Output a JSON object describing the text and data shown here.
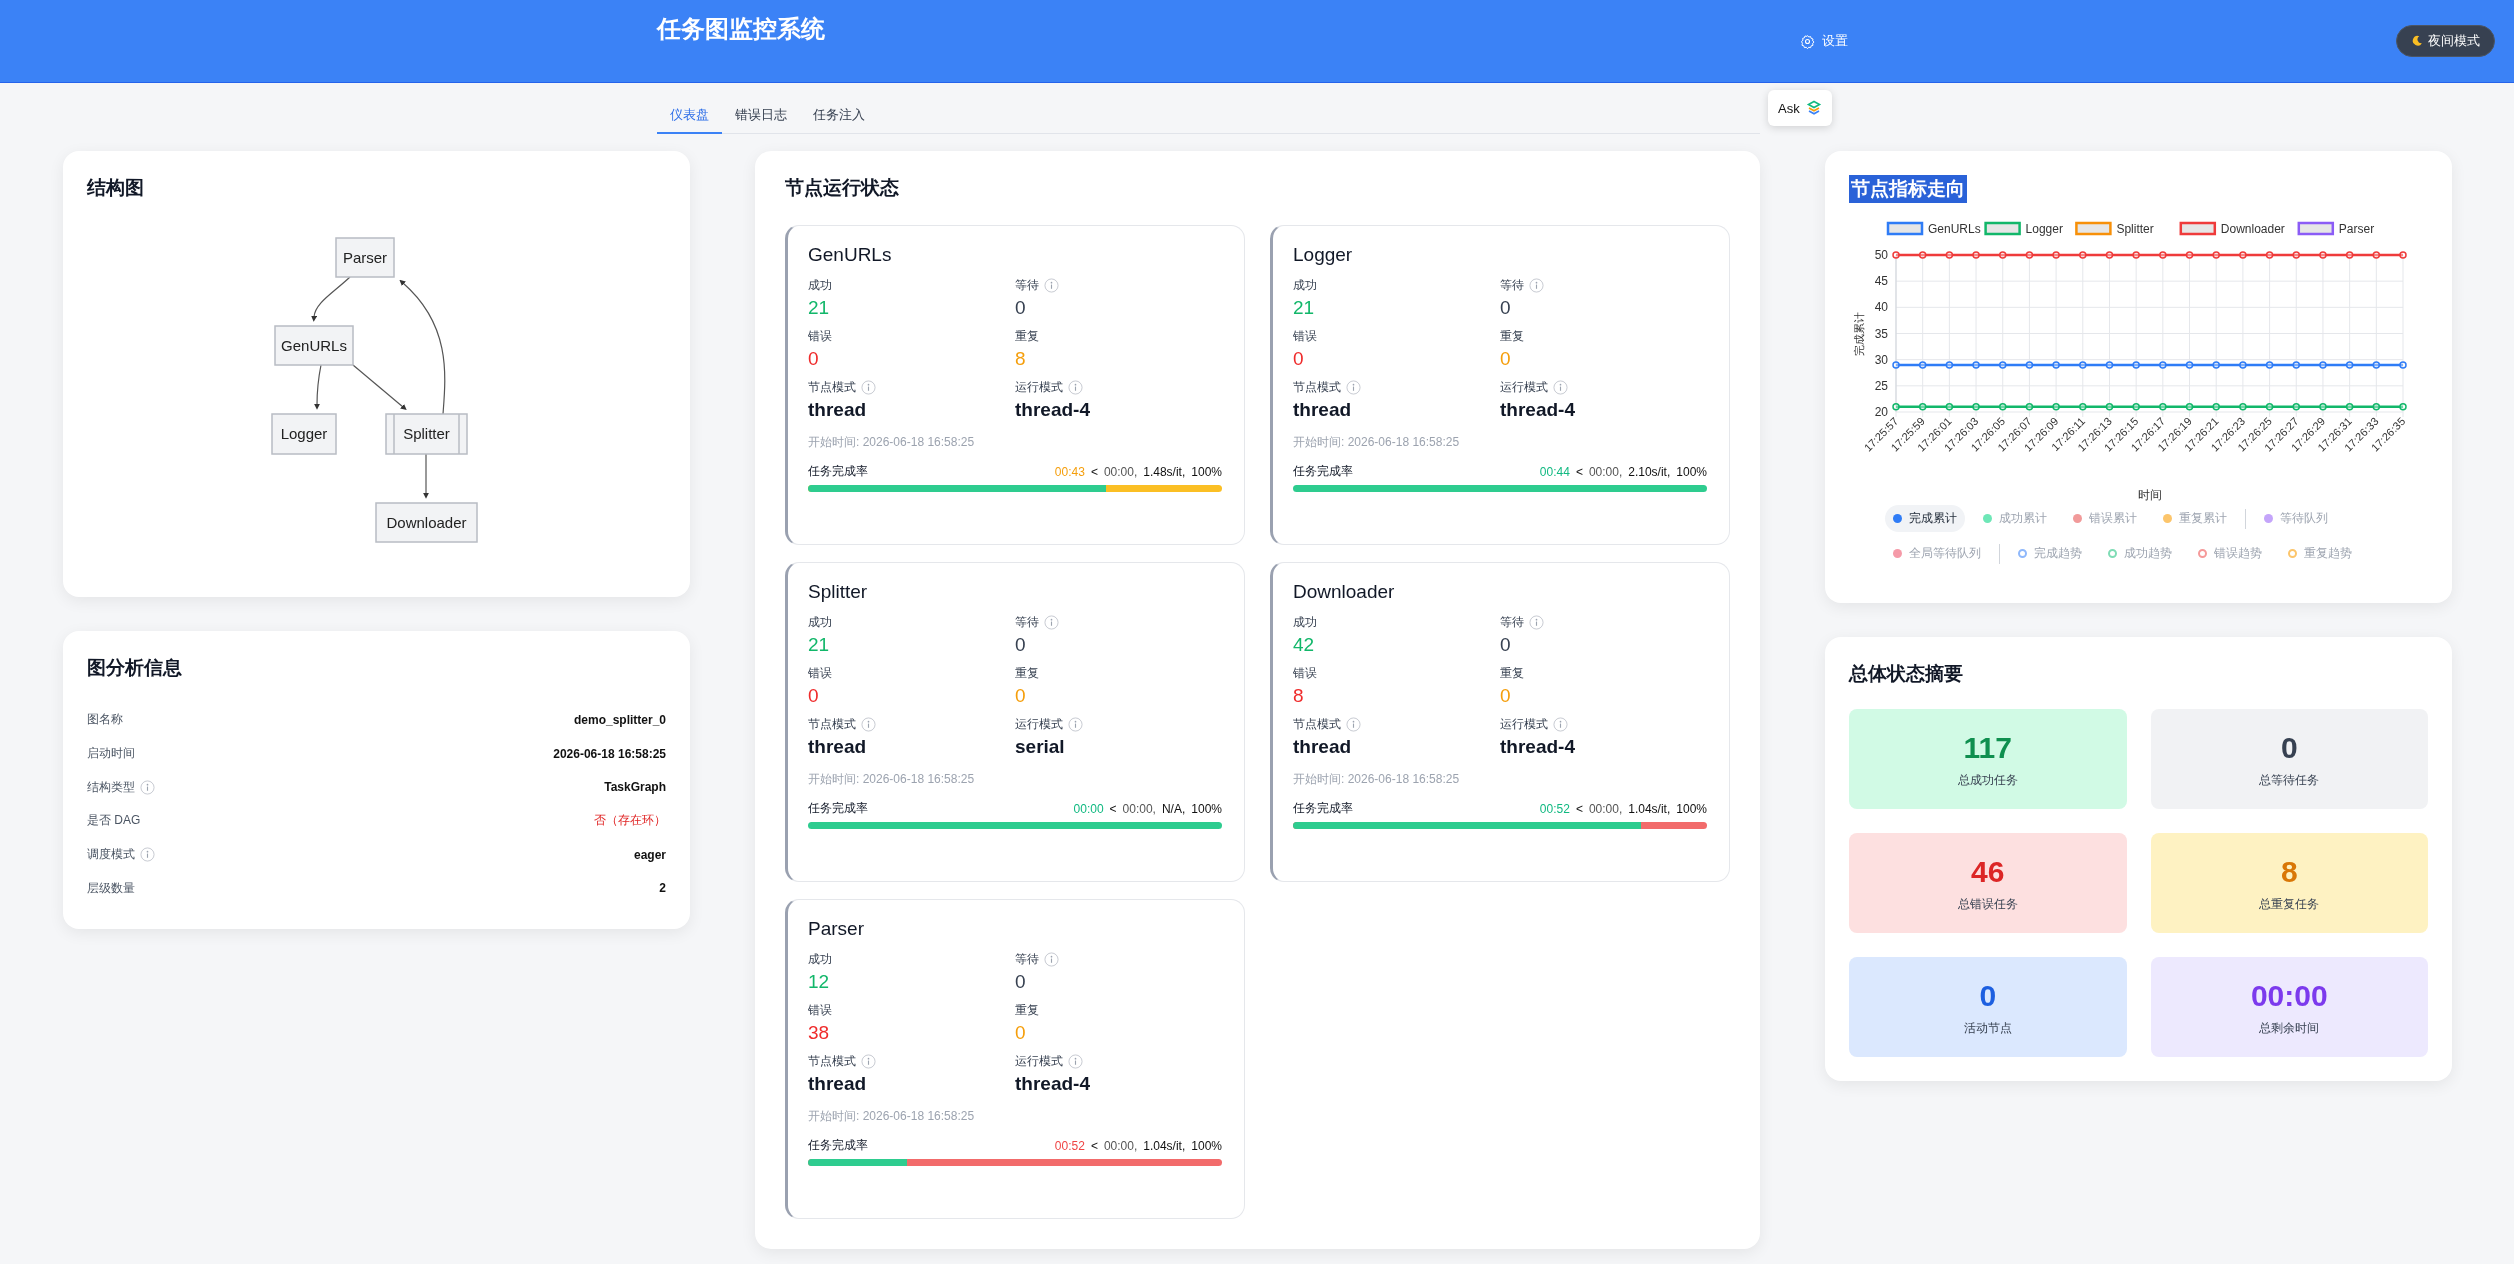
{
  "header": {
    "title": "任务图监控系统",
    "settings": {
      "label": "设置"
    },
    "night_mode": {
      "label": "夜间模式"
    }
  },
  "tabs": [
    {
      "label": "仪表盘",
      "selected": true
    },
    {
      "label": "错误日志",
      "selected": false
    },
    {
      "label": "任务注入",
      "selected": false
    }
  ],
  "ask_button": {
    "label": "Ask"
  },
  "structure": {
    "title": "结构图",
    "nodes": [
      {
        "label": "Parser",
        "kind": "process"
      },
      {
        "label": "GenURLs",
        "kind": "process"
      },
      {
        "label": "Logger",
        "kind": "process"
      },
      {
        "label": "Splitter",
        "kind": "subroutine"
      },
      {
        "label": "Downloader",
        "kind": "process"
      }
    ]
  },
  "graph_info": {
    "title": "图分析信息",
    "rows": [
      {
        "label": "图名称",
        "value": "demo_splitter_0",
        "info": false,
        "alert": false
      },
      {
        "label": "启动时间",
        "value": "2026-06-18 16:58:25",
        "info": false,
        "alert": false
      },
      {
        "label": "结构类型",
        "value": "TaskGraph",
        "info": true,
        "alert": false
      },
      {
        "label": "是否 DAG",
        "value": "否（存在环）",
        "info": false,
        "alert": true
      },
      {
        "label": "调度模式",
        "value": "eager",
        "info": true,
        "alert": false
      },
      {
        "label": "层级数量",
        "value": "2",
        "info": false,
        "alert": false
      }
    ]
  },
  "node_status": {
    "title": "节点运行状态",
    "nodes": [
      {
        "name": "GenURLs",
        "stats": [
          {
            "label": "成功",
            "value": "21",
            "kind": "success",
            "info": false
          },
          {
            "label": "等待",
            "value": "0",
            "kind": "waiting",
            "info": true
          },
          {
            "label": "错误",
            "value": "0",
            "kind": "error",
            "info": false
          },
          {
            "label": "重复",
            "value": "8",
            "kind": "duplicate",
            "info": false
          },
          {
            "label": "节点模式",
            "value": "thread",
            "kind": "mode",
            "info": true
          },
          {
            "label": "运行模式",
            "value": "thread-4",
            "kind": "mode",
            "info": true
          }
        ],
        "start_time": "开始时间: 2026-06-18 16:58:25",
        "progress": {
          "label": "任务完成率",
          "elapsed": {
            "text": "00:43",
            "color": "#f59e0b"
          },
          "separator": "<",
          "remaining": "00:00,",
          "rate": "1.48s/it,",
          "percent": "100%",
          "level": 0.72,
          "color": "#fbbf24"
        }
      },
      {
        "name": "Logger",
        "stats": [
          {
            "label": "成功",
            "value": "21",
            "kind": "success",
            "info": false
          },
          {
            "label": "等待",
            "value": "0",
            "kind": "waiting",
            "info": true
          },
          {
            "label": "错误",
            "value": "0",
            "kind": "error",
            "info": false
          },
          {
            "label": "重复",
            "value": "0",
            "kind": "duplicate",
            "info": false
          },
          {
            "label": "节点模式",
            "value": "thread",
            "kind": "mode",
            "info": true
          },
          {
            "label": "运行模式",
            "value": "thread-4",
            "kind": "mode",
            "info": true
          }
        ],
        "start_time": "开始时间: 2026-06-18 16:58:25",
        "progress": {
          "label": "任务完成率",
          "elapsed": {
            "text": "00:44",
            "color": "#10b981"
          },
          "separator": "<",
          "remaining": "00:00,",
          "rate": "2.10s/it,",
          "percent": "100%",
          "level": 1
        }
      },
      {
        "name": "Splitter",
        "stats": [
          {
            "label": "成功",
            "value": "21",
            "kind": "success",
            "info": false
          },
          {
            "label": "等待",
            "value": "0",
            "kind": "waiting",
            "info": true
          },
          {
            "label": "错误",
            "value": "0",
            "kind": "error",
            "info": false
          },
          {
            "label": "重复",
            "value": "0",
            "kind": "duplicate",
            "info": false
          },
          {
            "label": "节点模式",
            "value": "thread",
            "kind": "mode",
            "info": true
          },
          {
            "label": "运行模式",
            "value": "serial",
            "kind": "mode",
            "info": true
          }
        ],
        "start_time": "开始时间: 2026-06-18 16:58:25",
        "progress": {
          "label": "任务完成率",
          "elapsed": {
            "text": "00:00",
            "color": "#10b981"
          },
          "separator": "<",
          "remaining": "00:00,",
          "rate": "N/A,",
          "percent": "100%",
          "level": 1
        }
      },
      {
        "name": "Downloader",
        "stats": [
          {
            "label": "成功",
            "value": "42",
            "kind": "success",
            "info": false
          },
          {
            "label": "等待",
            "value": "0",
            "kind": "waiting",
            "info": true
          },
          {
            "label": "错误",
            "value": "8",
            "kind": "error",
            "info": false
          },
          {
            "label": "重复",
            "value": "0",
            "kind": "duplicate",
            "info": false
          },
          {
            "label": "节点模式",
            "value": "thread",
            "kind": "mode",
            "info": true
          },
          {
            "label": "运行模式",
            "value": "thread-4",
            "kind": "mode",
            "info": true
          }
        ],
        "start_time": "开始时间: 2026-06-18 16:58:25",
        "progress": {
          "label": "任务完成率",
          "elapsed": {
            "text": "00:52",
            "color": "#10b981"
          },
          "separator": "<",
          "remaining": "00:00,",
          "rate": "1.04s/it,",
          "percent": "100%",
          "level": 0.84,
          "color": "#f26b6b"
        }
      },
      {
        "name": "Parser",
        "stats": [
          {
            "label": "成功",
            "value": "12",
            "kind": "success",
            "info": false
          },
          {
            "label": "等待",
            "value": "0",
            "kind": "waiting",
            "info": true
          },
          {
            "label": "错误",
            "value": "38",
            "kind": "error",
            "info": false
          },
          {
            "label": "重复",
            "value": "0",
            "kind": "duplicate",
            "info": false
          },
          {
            "label": "节点模式",
            "value": "thread",
            "kind": "mode",
            "info": true
          },
          {
            "label": "运行模式",
            "value": "thread-4",
            "kind": "mode",
            "info": true
          }
        ],
        "start_time": "开始时间: 2026-06-18 16:58:25",
        "progress": {
          "label": "任务完成率",
          "elapsed": {
            "text": "00:52",
            "color": "#ef4444"
          },
          "separator": "<",
          "remaining": "00:00,",
          "rate": "1.04s/it,",
          "percent": "100%",
          "level": 0.24,
          "color": "#f26b6b"
        }
      }
    ]
  },
  "metrics": {
    "title": "节点指标走向",
    "title_selected": true,
    "chart_data": {
      "type": "line",
      "xlabel": "时间",
      "ylabel": "完成累计",
      "categories": [
        "17:25:57",
        "17:25:59",
        "17:26:01",
        "17:26:03",
        "17:26:05",
        "17:26:07",
        "17:26:09",
        "17:26:11",
        "17:26:13",
        "17:26:15",
        "17:26:17",
        "17:26:19",
        "17:26:21",
        "17:26:23",
        "17:26:25",
        "17:26:27",
        "17:26:29",
        "17:26:31",
        "17:26:33",
        "17:26:35"
      ],
      "ylim": [
        20,
        50
      ],
      "yticks": [
        20,
        25,
        30,
        35,
        40,
        45,
        50
      ],
      "series": [
        {
          "name": "GenURLs",
          "color": "#2f7cf6",
          "marker": "circle",
          "values": [
            29,
            29,
            29,
            29,
            29,
            29,
            29,
            29,
            29,
            29,
            29,
            29,
            29,
            29,
            29,
            29,
            29,
            29,
            29,
            29
          ]
        },
        {
          "name": "Logger",
          "color": "#12b76a",
          "marker": "circle",
          "values": [
            21,
            21,
            21,
            21,
            21,
            21,
            21,
            21,
            21,
            21,
            21,
            21,
            21,
            21,
            21,
            21,
            21,
            21,
            21,
            21
          ]
        },
        {
          "name": "Splitter",
          "color": "#f79009",
          "values": [
            null,
            null,
            null,
            null,
            null,
            null,
            null,
            null,
            null,
            null,
            null,
            null,
            null,
            null,
            null,
            null,
            null,
            null,
            null,
            null
          ]
        },
        {
          "name": "Downloader",
          "color": "#ef3b3b",
          "marker": "circle",
          "values": [
            50,
            50,
            50,
            50,
            50,
            50,
            50,
            50,
            50,
            50,
            50,
            50,
            50,
            50,
            50,
            50,
            50,
            50,
            50,
            50
          ]
        },
        {
          "name": "Parser",
          "color": "#8b5cf6",
          "values": [
            null,
            null,
            null,
            null,
            null,
            null,
            null,
            null,
            null,
            null,
            null,
            null,
            null,
            null,
            null,
            null,
            null,
            null,
            null,
            null
          ]
        }
      ],
      "grid": true,
      "legend": "top"
    },
    "toggle_rows": [
      [
        [
          {
            "label": "完成累计",
            "color": "#2f7cf6",
            "kind": "filled",
            "selected": true
          },
          {
            "label": "成功累计",
            "color": "#6ee7b7",
            "kind": "filled",
            "selected": false
          },
          {
            "label": "错误累计",
            "color": "#f19a9a",
            "kind": "filled",
            "selected": false
          },
          {
            "label": "重复累计",
            "color": "#fcc56b",
            "kind": "filled",
            "selected": false
          }
        ],
        [
          {
            "label": "等待队列",
            "color": "#c4a5fa",
            "kind": "filled",
            "selected": false
          }
        ]
      ],
      [
        [
          {
            "label": "全局等待队列",
            "color": "#f59aa8",
            "kind": "filled",
            "selected": false
          }
        ],
        [
          {
            "label": "完成趋势",
            "color": "#8fb8fb",
            "kind": "hollow",
            "selected": false
          },
          {
            "label": "成功趋势",
            "color": "#7fdcb5",
            "kind": "hollow",
            "selected": false
          },
          {
            "label": "错误趋势",
            "color": "#f59a9a",
            "kind": "hollow",
            "selected": false
          },
          {
            "label": "重复趋势",
            "color": "#fcc56b",
            "kind": "hollow",
            "selected": false
          }
        ]
      ]
    ]
  },
  "summary": {
    "title": "总体状态摘要",
    "tiles": [
      {
        "value": "117",
        "label": "总成功任务",
        "kind": "success"
      },
      {
        "value": "0",
        "label": "总等待任务",
        "kind": "waiting"
      },
      {
        "value": "46",
        "label": "总错误任务",
        "kind": "error"
      },
      {
        "value": "8",
        "label": "总重复任务",
        "kind": "duplicate"
      },
      {
        "value": "0",
        "label": "活动节点",
        "kind": "active"
      },
      {
        "value": "00:00",
        "label": "总剩余时间",
        "kind": "time"
      }
    ]
  }
}
